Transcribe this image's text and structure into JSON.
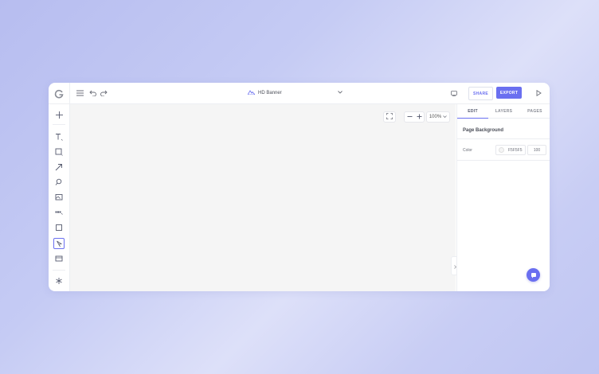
{
  "header": {
    "document_title": "HD Banner",
    "share_label": "SHARE",
    "export_label": "EXPORT"
  },
  "canvas": {
    "zoom_level": "100%"
  },
  "right_panel": {
    "tabs": [
      {
        "label": "EDIT",
        "active": true
      },
      {
        "label": "LAYERS",
        "active": false
      },
      {
        "label": "PAGES",
        "active": false
      }
    ],
    "section_title": "Page Background",
    "color_label": "Color",
    "color_hex": "F5F5F5",
    "opacity": "100"
  },
  "colors": {
    "accent": "#6a6ff0",
    "canvas": "#f5f5f5",
    "swatch": "#f5f5f5"
  },
  "sidebar": {
    "tools": [
      "add-icon",
      "text-icon",
      "shape-icon",
      "arrow-icon",
      "search-image-icon",
      "image-icon",
      "component-icon",
      "frame-icon",
      "select-icon",
      "media-icon",
      "settings-icon"
    ]
  }
}
